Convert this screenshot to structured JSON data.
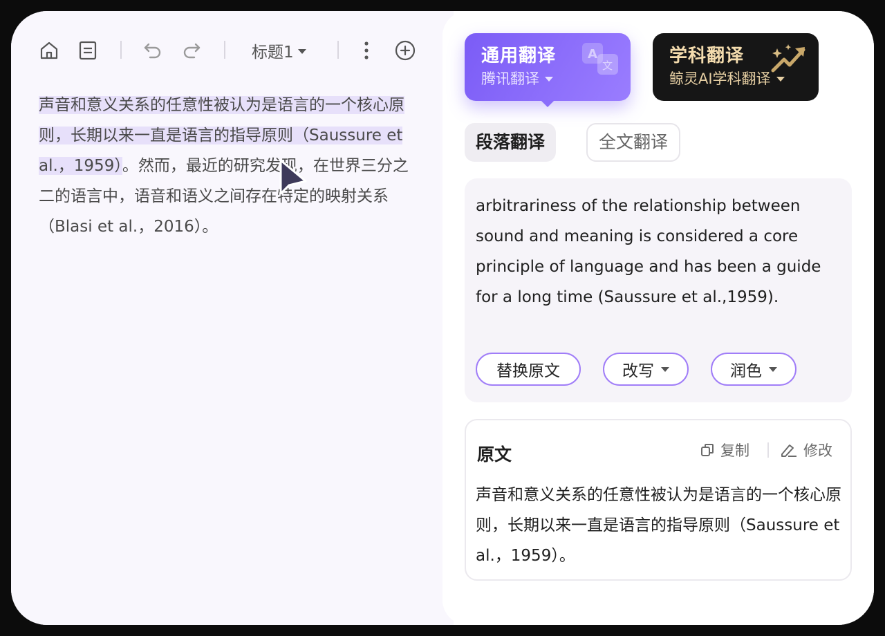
{
  "editor": {
    "toolbar": {
      "heading_label": "标题1",
      "icons": [
        "home-icon",
        "document-icon",
        "undo-icon",
        "redo-icon",
        "more-vertical-icon",
        "add-circle-icon"
      ]
    },
    "paragraph": {
      "highlighted": "声音和意义关系的任意性被认为是语言的一个核心原则，长期以来一直是语言的指导原则（Saussure et al.，1959）",
      "rest": "。然而，最近的研究发现，在世界三分之二的语言中，语音和语义之间存在特定的映射关系（Blasi et al.，2016）。"
    }
  },
  "panel": {
    "engines": [
      {
        "title": "通用翻译",
        "provider": "腾讯翻译"
      },
      {
        "title": "学科翻译",
        "provider": "鲸灵AI学科翻译"
      }
    ],
    "modes": {
      "paragraph": "段落翻译",
      "full": "全文翻译"
    },
    "result": {
      "text": "arbitrariness of the relationship between sound and meaning is considered a core principle of language and has been a guide for a long time (Saussure et al.,1959).",
      "actions": {
        "replace": "替换原文",
        "rewrite": "改写",
        "polish": "润色"
      }
    },
    "original": {
      "label": "原文",
      "copy": "复制",
      "edit": "修改",
      "text": "声音和意义关系的任意性被认为是语言的一个核心原则，长期以来一直是语言的指导原则（Saussure et al.，1959）。"
    }
  },
  "colors": {
    "accent": "#7b5cf6",
    "highlight": "#e7e0fa",
    "subject_card": "#161616",
    "subject_text": "#f4dcae"
  }
}
